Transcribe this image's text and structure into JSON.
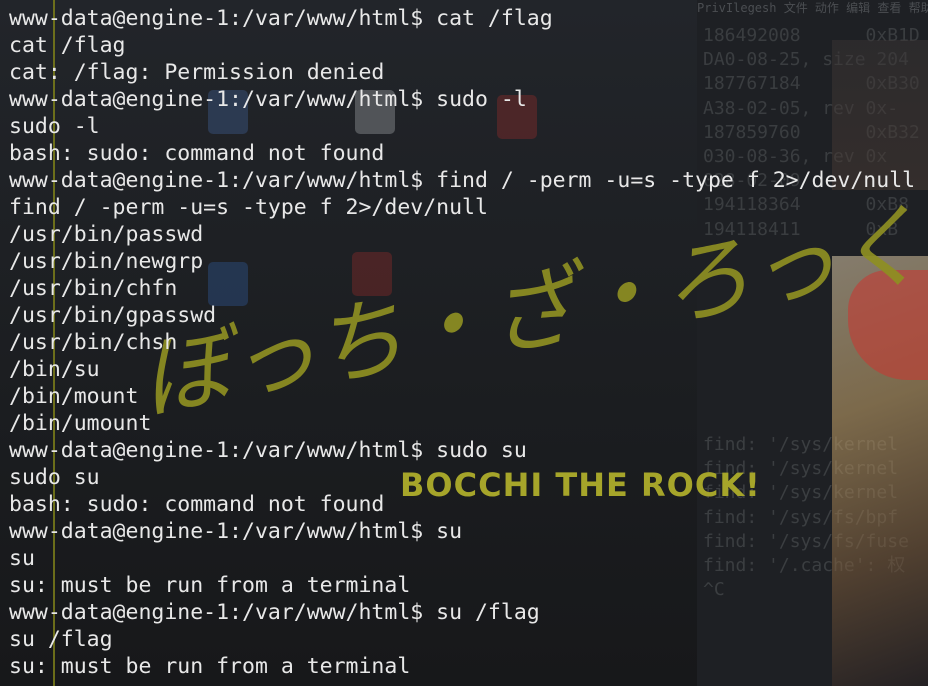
{
  "background_window": {
    "menu": "PrivIlegesh  文件  动作  编辑  查看  帮助",
    "lines": [
      "186492008      0xB1D",
      "DA0-08-25, size 204",
      "187767184      0xB30",
      "A38-02-05, rev 0x-",
      "187859760      0xB32",
      "030-08-36, rev 0x",
      "028-02-09",
      "194118364      0xB8",
      "194118411      0xB"
    ],
    "lines2": [
      "find: '/sys/kernel",
      "find: '/sys/kernel",
      "find: '/sys/kernel",
      "find: '/sys/fs/bpf",
      "find: '/sys/fs/fuse",
      "find: '/.cache': 权",
      "^C"
    ]
  },
  "logo": {
    "japanese": "ぼっち・ざ・ろっく!",
    "english": "BOCCHI THE ROCK!"
  },
  "terminal": {
    "lines": [
      "www-data@engine-1:/var/www/html$ cat /flag",
      "cat /flag",
      "cat: /flag: Permission denied",
      "www-data@engine-1:/var/www/html$ sudo -l",
      "sudo -l",
      "bash: sudo: command not found",
      "www-data@engine-1:/var/www/html$ find / -perm -u=s -type f 2>/dev/null",
      "find / -perm -u=s -type f 2>/dev/null",
      "/usr/bin/passwd",
      "/usr/bin/newgrp",
      "/usr/bin/chfn",
      "/usr/bin/gpasswd",
      "/usr/bin/chsh",
      "/bin/su",
      "/bin/mount",
      "/bin/umount",
      "www-data@engine-1:/var/www/html$ sudo su",
      "sudo su",
      "bash: sudo: command not found",
      "www-data@engine-1:/var/www/html$ su",
      "su",
      "su: must be run from a terminal",
      "www-data@engine-1:/var/www/html$ su /flag",
      "su /flag",
      "su: must be run from a terminal"
    ]
  },
  "colors": {
    "terminal_text": "#e8e8e8",
    "logo": "#8e8f22",
    "accent_line": "#7a7d1a"
  }
}
